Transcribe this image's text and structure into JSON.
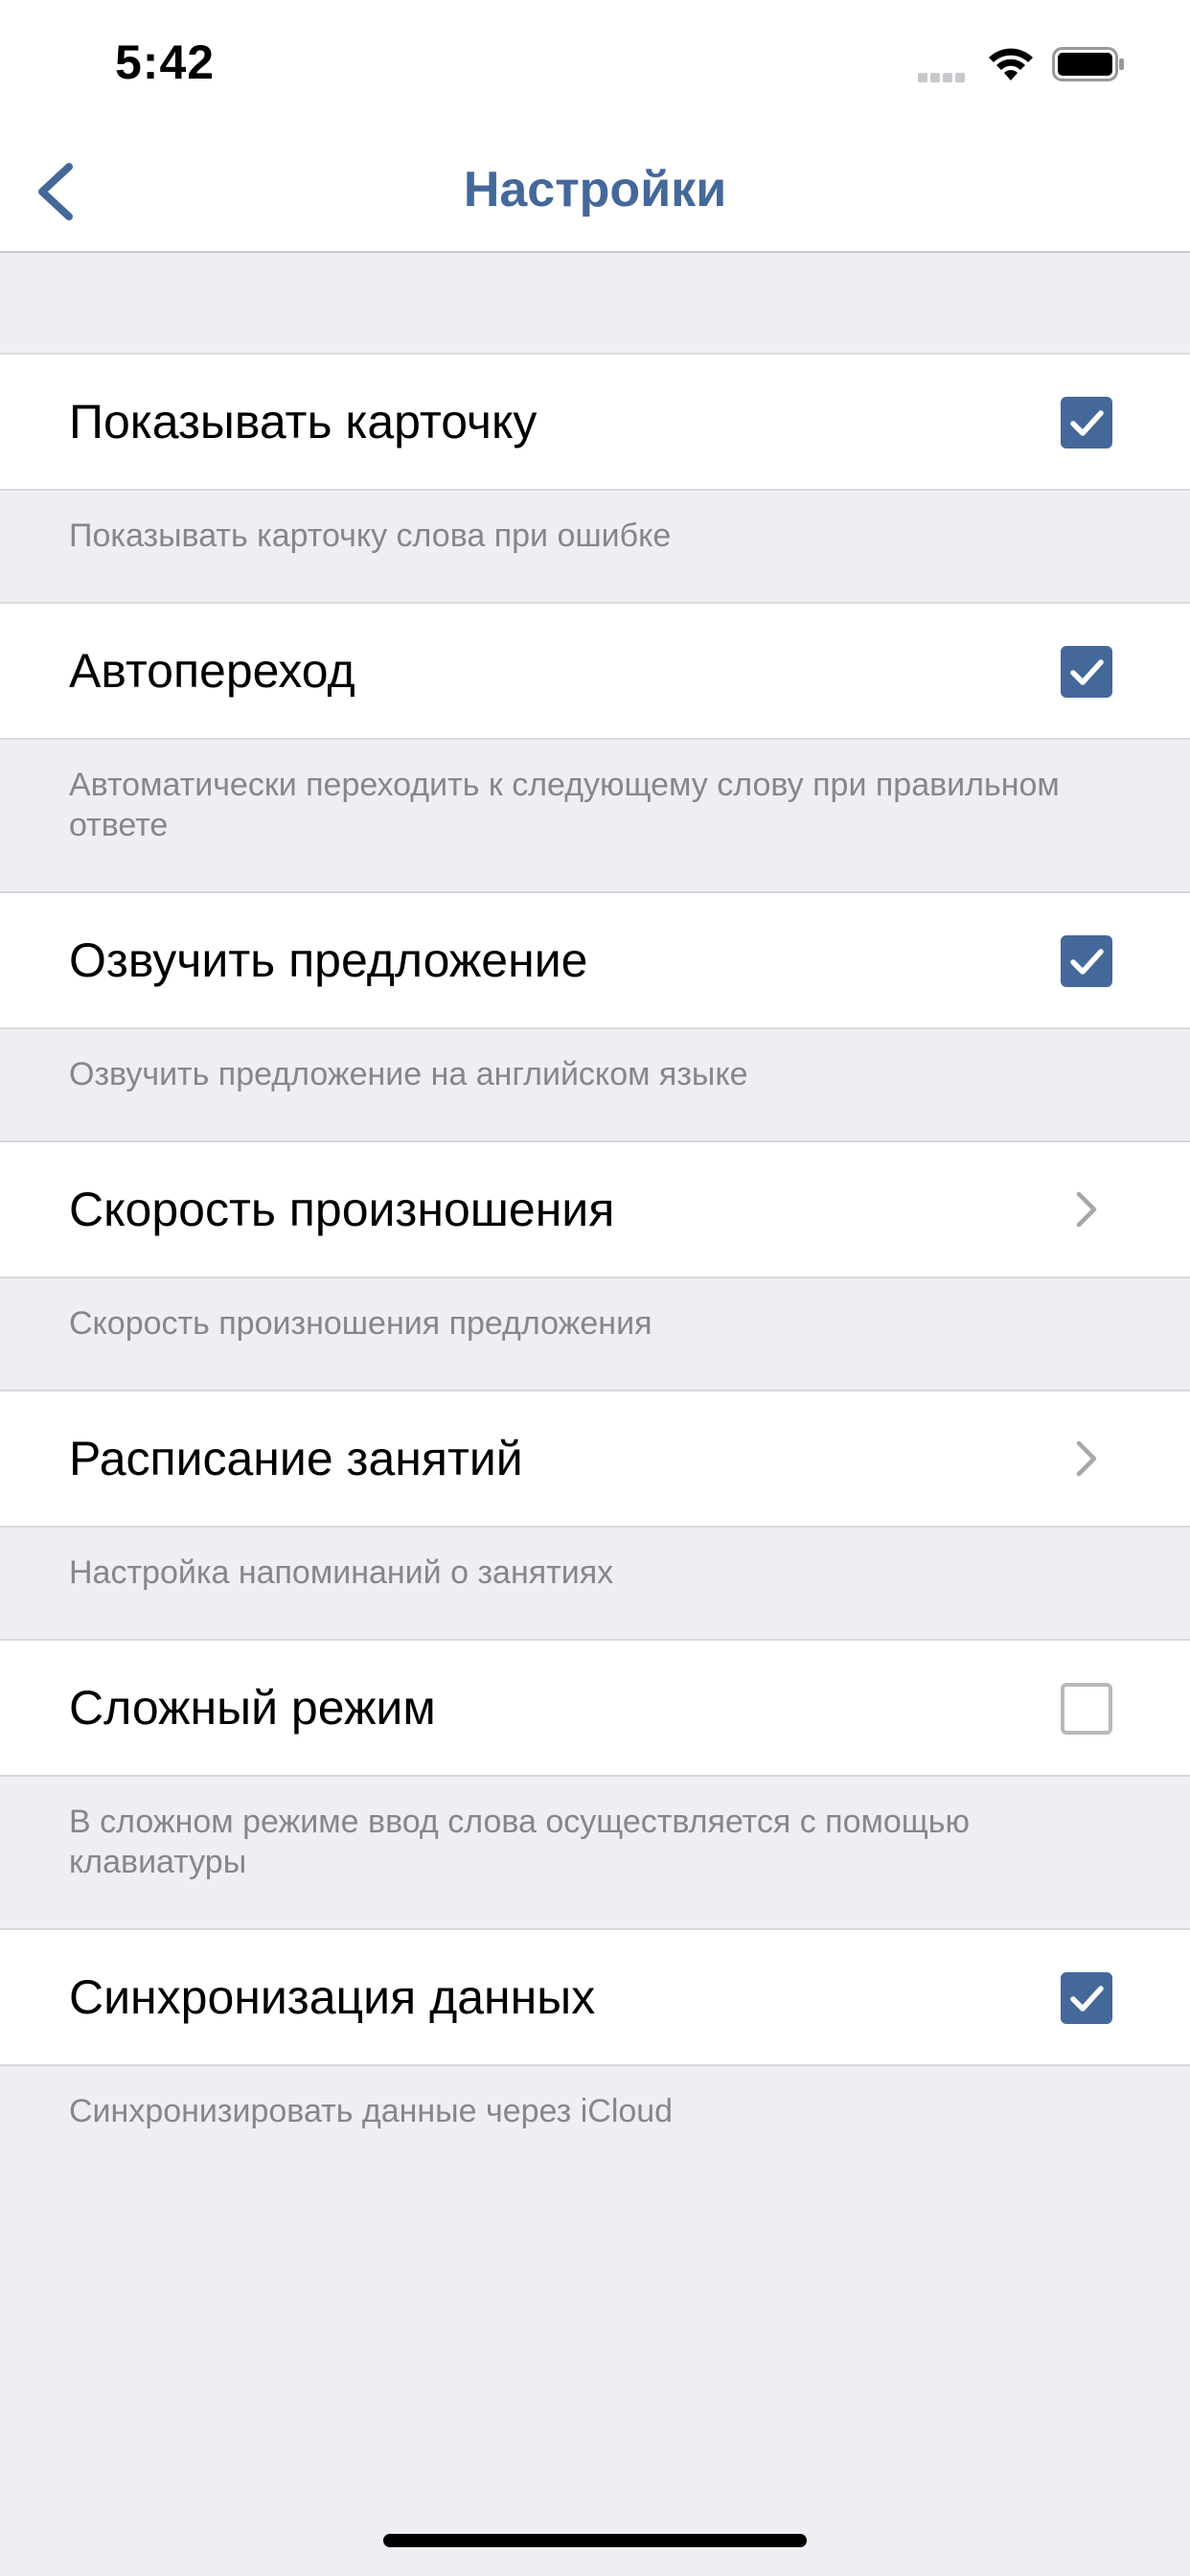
{
  "status_bar": {
    "time": "5:42"
  },
  "nav": {
    "title": "Настройки",
    "back_icon": "chevron-left-icon"
  },
  "colors": {
    "accent": "#44689A",
    "background": "#EEEEF3",
    "footer_text": "#86868B"
  },
  "settings": [
    {
      "label": "Показывать карточку",
      "control": "checkbox",
      "checked": true,
      "description": "Показывать карточку слова при ошибке"
    },
    {
      "label": "Автопереход",
      "control": "checkbox",
      "checked": true,
      "description": "Автоматически переходить к следующему слову при правильном ответе"
    },
    {
      "label": "Озвучить предложение",
      "control": "checkbox",
      "checked": true,
      "description": "Озвучить предложение на английском языке"
    },
    {
      "label": "Скорость произношения",
      "control": "disclosure",
      "description": "Скорость произношения предложения"
    },
    {
      "label": "Расписание занятий",
      "control": "disclosure",
      "description": "Настройка напоминаний о занятиях"
    },
    {
      "label": "Сложный режим",
      "control": "checkbox",
      "checked": false,
      "description": "В сложном режиме ввод слова осуществляется с помощью клавиатуры"
    },
    {
      "label": "Синхронизация данных",
      "control": "checkbox",
      "checked": true,
      "description": "Синхронизировать данные через iCloud"
    }
  ]
}
